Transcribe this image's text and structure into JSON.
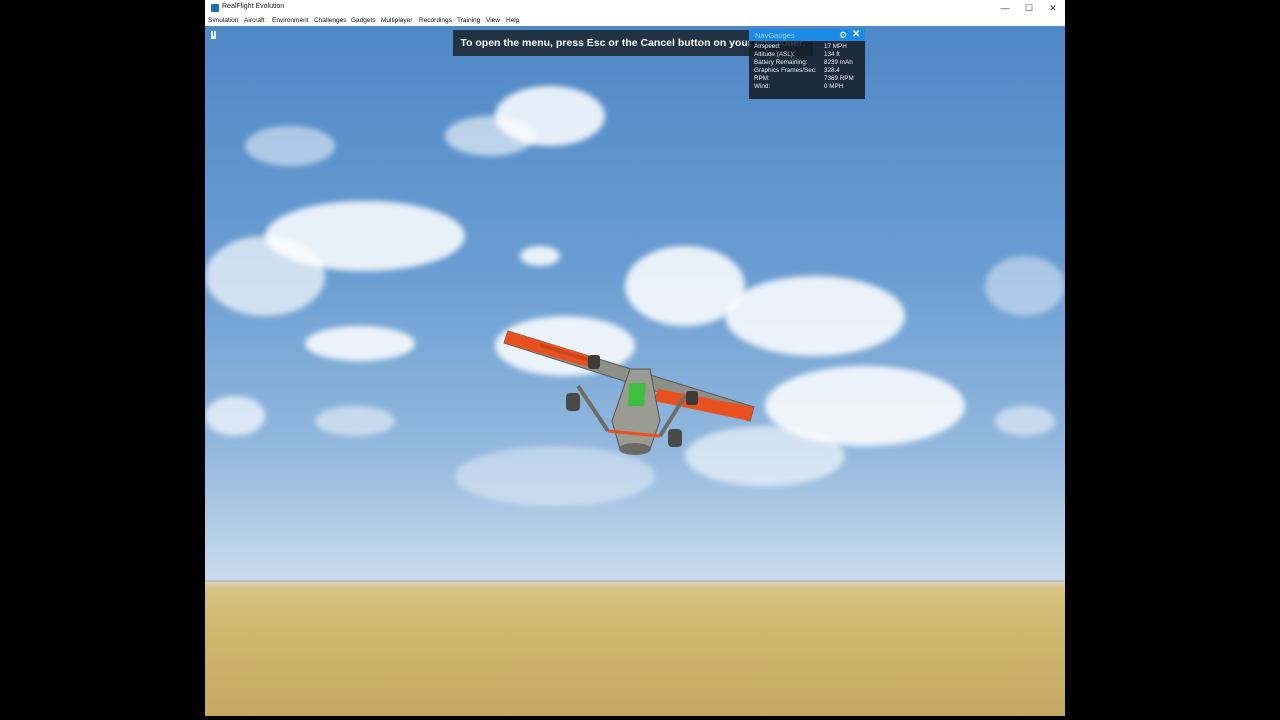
{
  "window": {
    "title": "RealFlight Evolution",
    "controls": {
      "minimize": "—",
      "maximize": "☐",
      "close": "✕"
    }
  },
  "menu": [
    "Simulation",
    "Aircraft",
    "Environment",
    "Challenges",
    "Gadgets",
    "Multiplayer",
    "Recordings",
    "Training",
    "View",
    "Help"
  ],
  "banner": {
    "text": "To open the menu, press Esc or the Cancel button on your controller."
  },
  "nav_panel": {
    "title": "NavGauges",
    "rows": [
      {
        "label": "Airspeed:",
        "value": "17 MPH"
      },
      {
        "label": "Altitude (ASL):",
        "value": "134 ft"
      },
      {
        "label": "Battery Remaining:",
        "value": "8239 mAh"
      },
      {
        "label": "Graphics Frames/Sec:",
        "value": "328.4"
      },
      {
        "label": "RPM:",
        "value": "7369 RPM"
      },
      {
        "label": "Wind:",
        "value": "0 MPH"
      }
    ]
  },
  "colors": {
    "accent": "#1a8be8",
    "sky": "#5a90cc",
    "ground": "#cfb66f",
    "aircraft_trim": "#e8501f",
    "aircraft_body": "#8a8a80"
  }
}
